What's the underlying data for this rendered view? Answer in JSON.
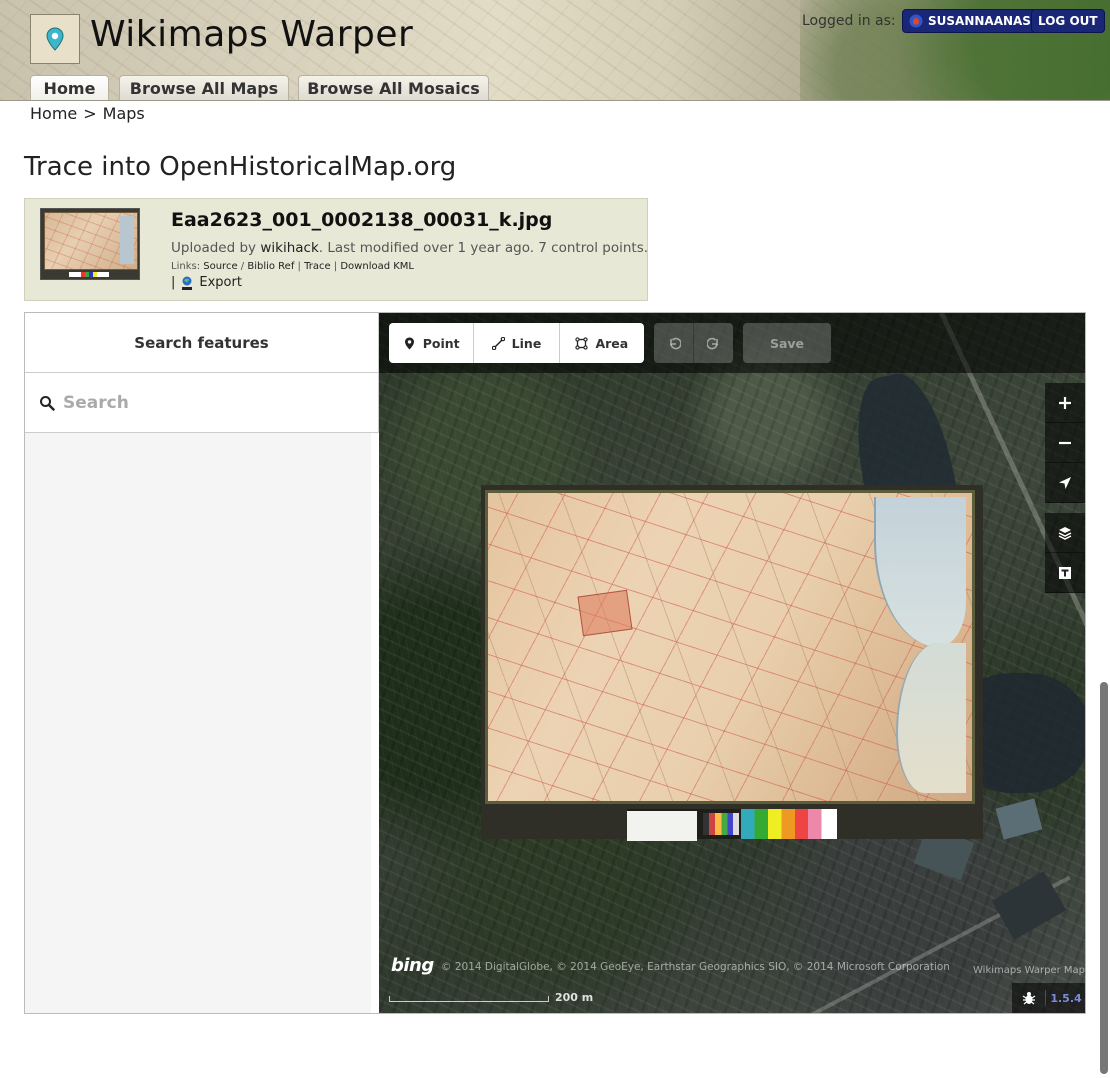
{
  "header": {
    "site_title": "Wikimaps Warper",
    "logged_in_label": "Logged in as:",
    "username": "SUSANNAANAS",
    "logout_label": "LOG OUT",
    "tabs": [
      {
        "label": "Home"
      },
      {
        "label": "Browse All Maps"
      },
      {
        "label": "Browse All Mosaics"
      }
    ]
  },
  "breadcrumb": {
    "home": "Home",
    "separator": ">",
    "current": "Maps"
  },
  "page_title": "Trace into OpenHistoricalMap.org",
  "map_info": {
    "filename": "Eaa2623_001_0002138_00031_k.jpg",
    "uploaded_prefix": "Uploaded by ",
    "uploader": "wikihack",
    "uploaded_suffix": ". Last modified over 1 year ago. 7 control points.",
    "links_label": "Links:",
    "links": [
      "Source",
      "Biblio Ref",
      "Trace",
      "Download KML"
    ],
    "export_prefix": "|",
    "export_label": "Export"
  },
  "editor": {
    "sidebar_title": "Search features",
    "search_placeholder": "Search",
    "tools": [
      {
        "label": "Point",
        "icon": "pin-icon"
      },
      {
        "label": "Line",
        "icon": "line-icon"
      },
      {
        "label": "Area",
        "icon": "area-icon"
      }
    ],
    "save_label": "Save",
    "attribution": "© 2014 DigitalGlobe, © 2014 GeoEye, Earthstar Geographics SIO, © 2014 Microsoft Corporation",
    "bing_label": "bing",
    "source_label": "Wikimaps Warper Map",
    "scale_label": "200 m",
    "version": "1.5.4"
  },
  "colors": {
    "user_button_bg": "#1a2676",
    "info_box_bg": "#e8e8d6",
    "version_color": "#7b8bd8"
  }
}
